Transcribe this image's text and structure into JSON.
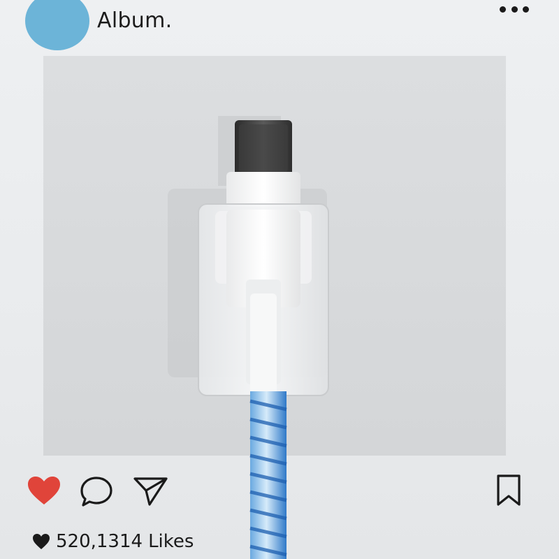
{
  "post": {
    "username": "Album.",
    "likes_count": "520,1314",
    "likes_label": "Likes"
  },
  "icons": {
    "avatar": "avatar",
    "more": "more-horizontal-icon",
    "like": "heart-icon",
    "comment": "comment-icon",
    "share": "send-icon",
    "save": "bookmark-icon",
    "likes": "heart-small-icon"
  },
  "colors": {
    "avatar": "#6cb4d8",
    "like_heart": "#e0443a",
    "cable_blue": "#3d8fd8"
  }
}
